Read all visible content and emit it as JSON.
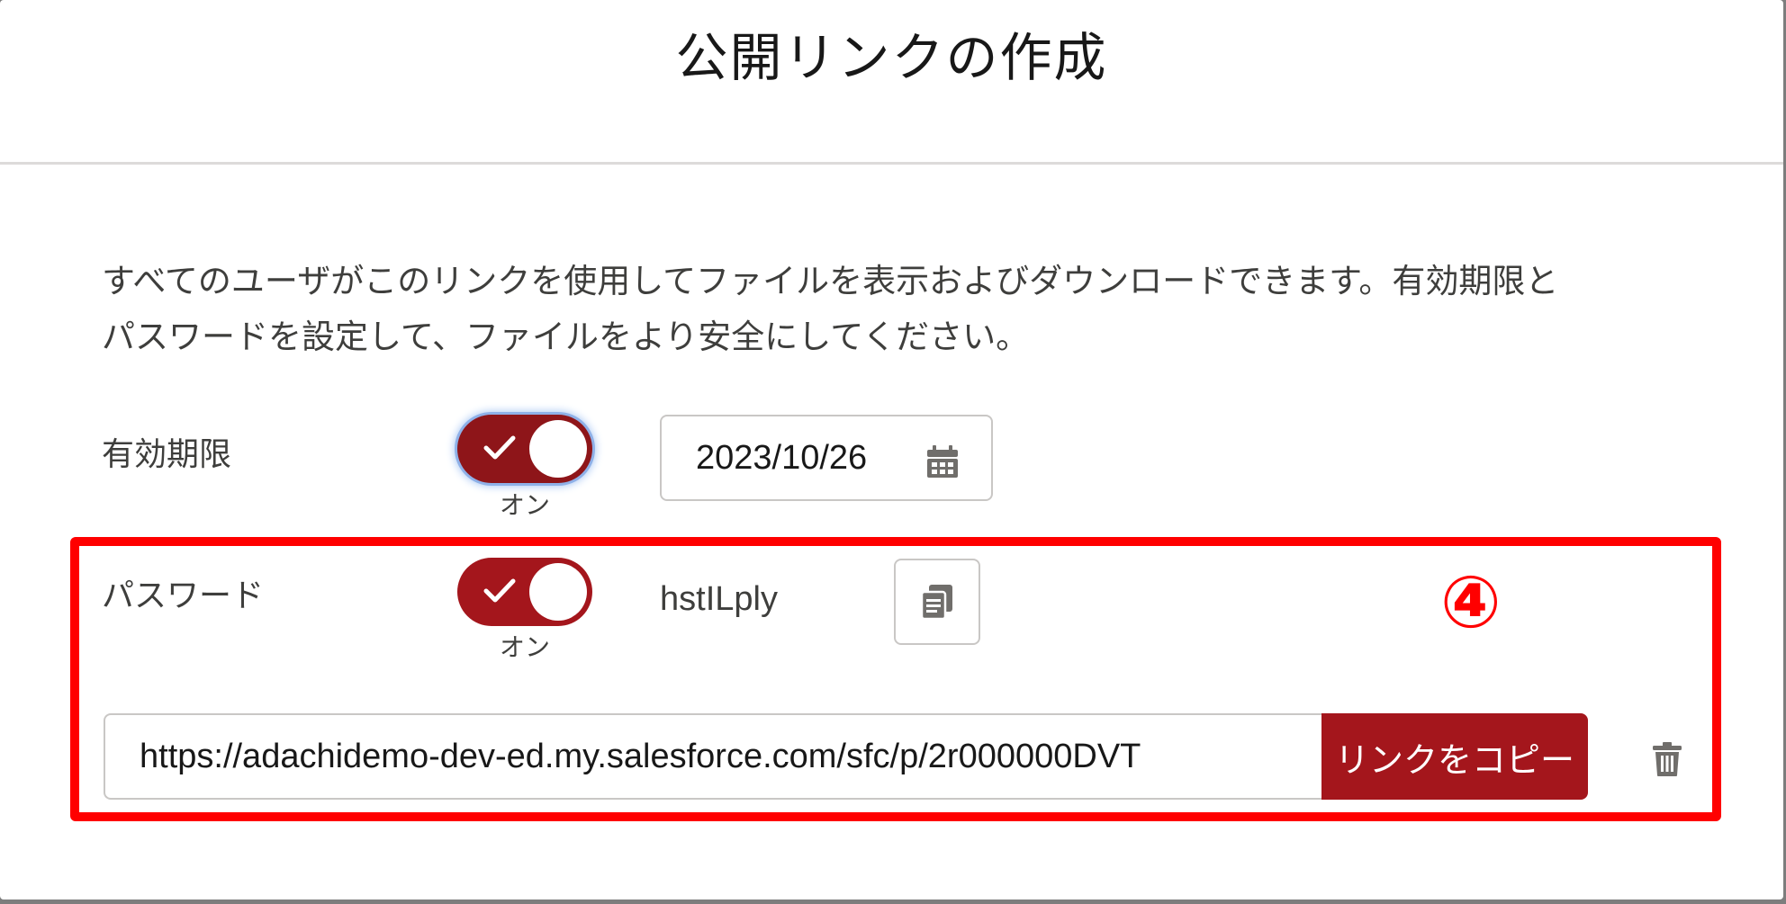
{
  "modal": {
    "title": "公開リンクの作成",
    "description_line1": "すべてのユーザがこのリンクを使用してファイルを表示およびダウンロードできます。有効期限と",
    "description_line2": "パスワードを設定して、ファイルをより安全にしてください。"
  },
  "expiration": {
    "label": "有効期限",
    "toggle_state": "オン",
    "toggle_on": true,
    "date_value": "2023/10/26",
    "icon": "calendar-icon"
  },
  "password": {
    "label": "パスワード",
    "toggle_state": "オン",
    "toggle_on": true,
    "value": "hstILply",
    "copy_icon": "copy-icon"
  },
  "link": {
    "url": "https://adachidemo-dev-ed.my.salesforce.com/sfc/p/2r000000DVT",
    "copy_button_label": "リンクをコピー",
    "delete_icon": "trash-icon"
  },
  "annotation": {
    "step": "④"
  },
  "colors": {
    "brand": "#a4161c",
    "annotation": "#ff0000"
  }
}
